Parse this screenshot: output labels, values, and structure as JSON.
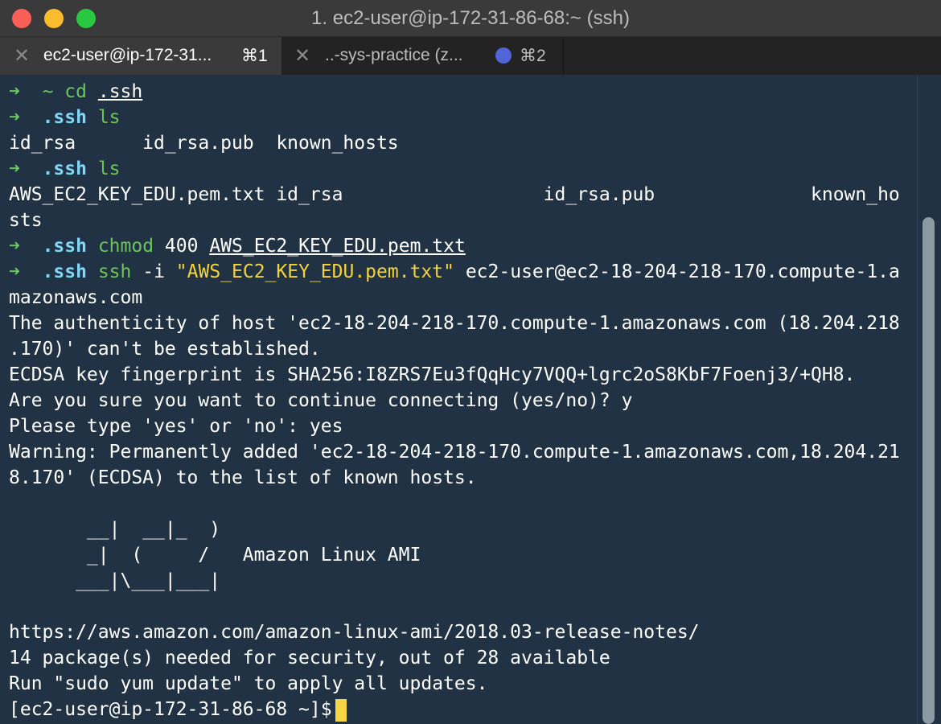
{
  "window": {
    "title": "1. ec2-user@ip-172-31-86-68:~ (ssh)",
    "accent": "#f7d443",
    "prompt_color": "#6ec45a",
    "dir_color": "#7fd8f5",
    "bg_color": "#203244"
  },
  "tabs": [
    {
      "label": "ec2-user@ip-172-31...",
      "shortcut": "⌘1",
      "active": true,
      "close_icon": "close-icon"
    },
    {
      "label": "..-sys-practice (z...",
      "shortcut": "⌘2",
      "active": false,
      "close_icon": "close-icon",
      "badge_icon": "blue-dot-icon"
    }
  ],
  "terminal": {
    "l1": {
      "arrow": "➜",
      "dir": "~",
      "cmd": "cd",
      "arg": ".ssh"
    },
    "l2": {
      "arrow": "➜",
      "dir": ".ssh",
      "cmd": "ls"
    },
    "l3": "id_rsa      id_rsa.pub  known_hosts",
    "l4": {
      "arrow": "➜",
      "dir": ".ssh",
      "cmd": "ls"
    },
    "l5": "AWS_EC2_KEY_EDU.pem.txt id_rsa                  id_rsa.pub              known_ho",
    "l6": "sts",
    "l7": {
      "arrow": "➜",
      "dir": ".ssh",
      "cmd": "chmod",
      "num": "400",
      "arg": "AWS_EC2_KEY_EDU.pem.txt"
    },
    "l8": {
      "arrow": "➜",
      "dir": ".ssh",
      "cmd": "ssh",
      "flag": "-i",
      "arg": "\"AWS_EC2_KEY_EDU.pem.txt\"",
      "host": "ec2-user@ec2-18-204-218-170.compute-1.a"
    },
    "l9": "mazonaws.com",
    "l10": "The authenticity of host 'ec2-18-204-218-170.compute-1.amazonaws.com (18.204.218",
    "l11": ".170)' can't be established.",
    "l12": "ECDSA key fingerprint is SHA256:I8ZRS7Eu3fQqHcy7VQQ+lgrc2oS8KbF7Foenj3/+QH8.",
    "l13": "Are you sure you want to continue connecting (yes/no)? y",
    "l14": "Please type 'yes' or 'no': yes",
    "l15": "Warning: Permanently added 'ec2-18-204-218-170.compute-1.amazonaws.com,18.204.21",
    "l16": "8.170' (ECDSA) to the list of known hosts.",
    "l17": "       __|  __|_  )",
    "l18": "       _|  (     /   Amazon Linux AMI",
    "l19": "      ___|\\___|___|",
    "l20": "https://aws.amazon.com/amazon-linux-ami/2018.03-release-notes/",
    "l21": "14 package(s) needed for security, out of 28 available",
    "l22": "Run \"sudo yum update\" to apply all updates.",
    "l23": "[ec2-user@ip-172-31-86-68 ~]$"
  }
}
